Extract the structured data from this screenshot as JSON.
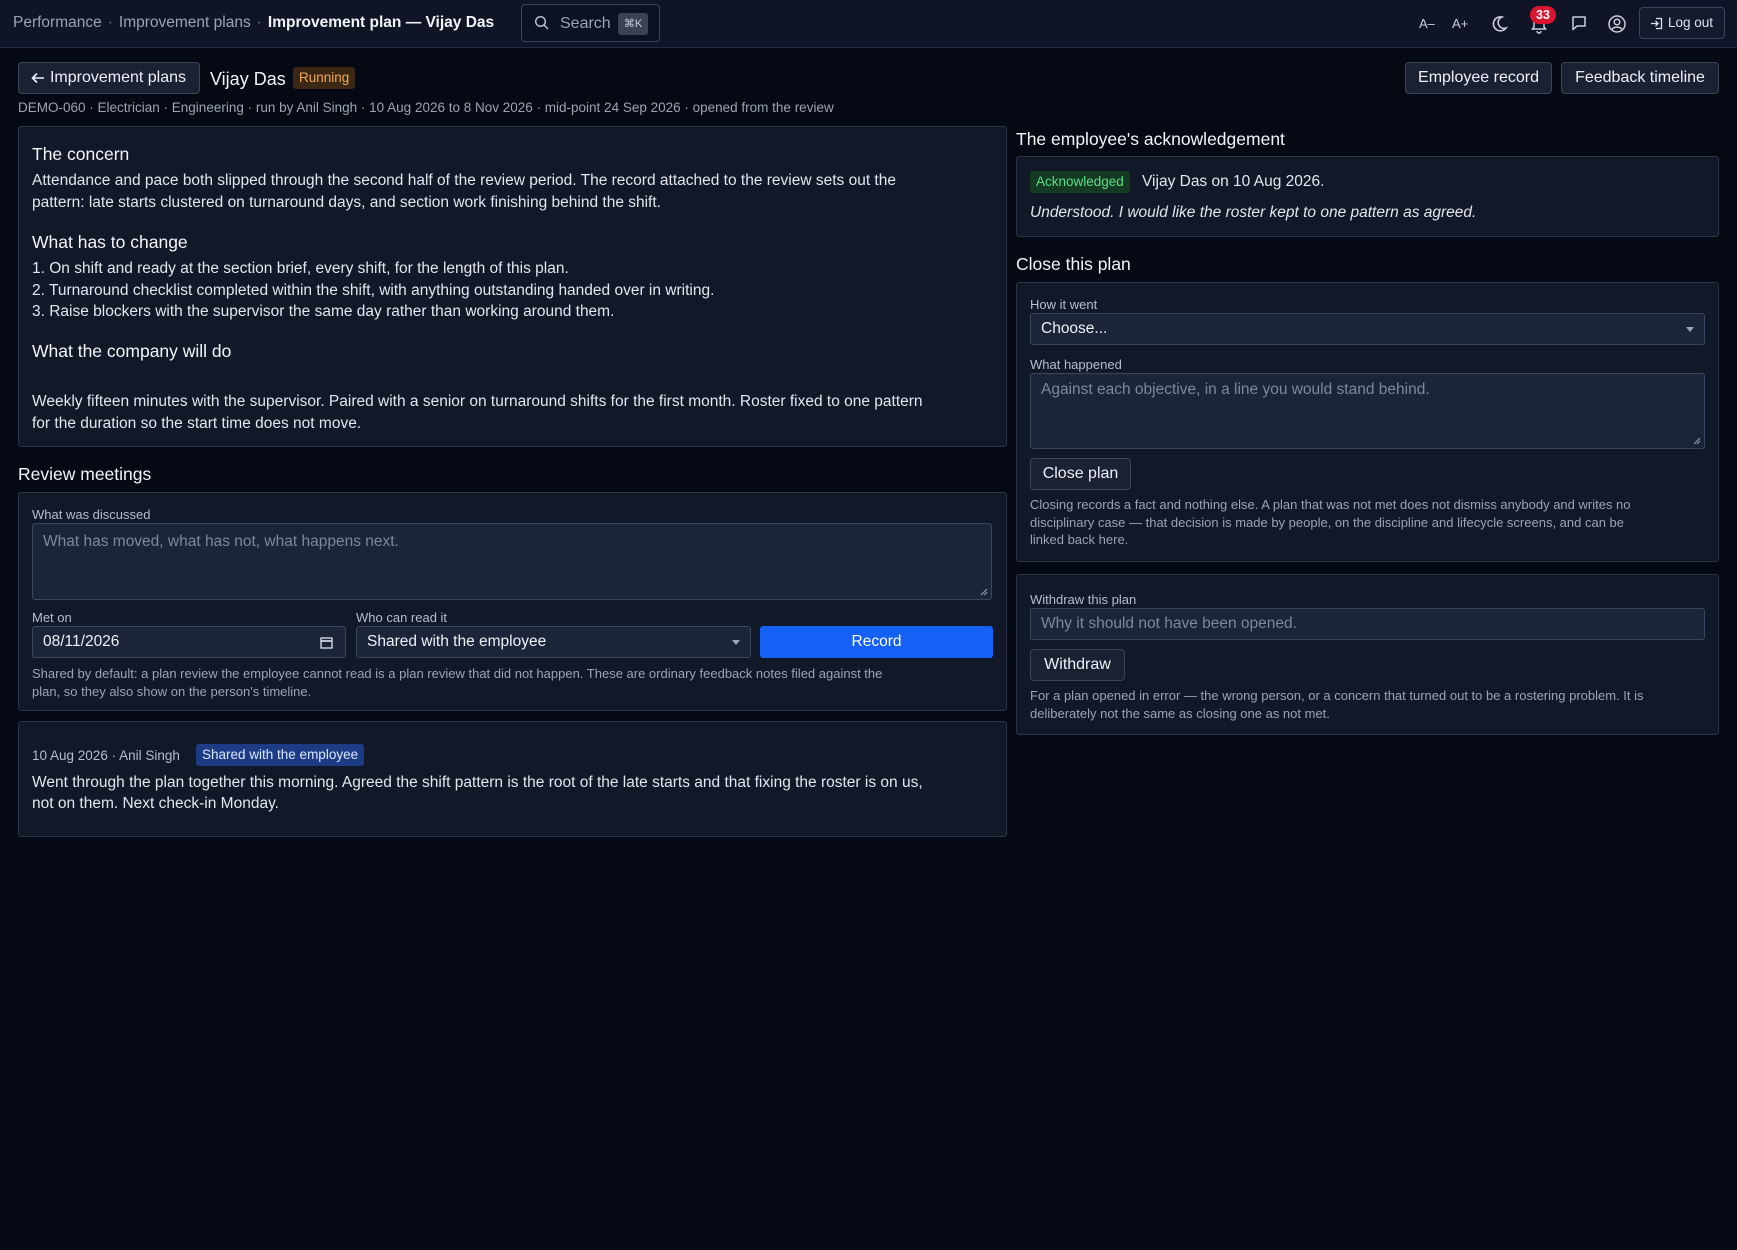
{
  "breadcrumb": {
    "items": [
      "Performance",
      "Improvement plans"
    ],
    "separator": "·",
    "current": "Improvement plan — Vijay Das"
  },
  "search": {
    "label": "Search",
    "shortcut": "⌘K"
  },
  "topbar": {
    "font_smaller": "A–",
    "font_larger": "A+",
    "notification_count": "33",
    "logout_label": "Log out"
  },
  "header": {
    "back_label": "Improvement plans",
    "employee_name": "Vijay Das",
    "status": "Running",
    "employee_record_label": "Employee record",
    "feedback_timeline_label": "Feedback timeline",
    "meta": "DEMO-060 · Electrician · Engineering · run by Anil Singh · 10 Aug 2026 to 8 Nov 2026 · mid-point 24 Sep 2026 · opened from the review"
  },
  "plan": {
    "concern_title": "The concern",
    "concern_line1": "Attendance and pace both slipped through the second half of the review period. The record attached to the review sets out the",
    "concern_line2": "pattern: late starts clustered on turnaround days, and section work finishing behind the shift.",
    "change_title": "What has to change",
    "change_items": [
      "1. On shift and ready at the section brief, every shift, for the length of this plan.",
      "2. Turnaround checklist completed within the shift, with anything outstanding handed over in writing.",
      "3. Raise blockers with the supervisor the same day rather than working around them."
    ],
    "company_title": "What the company will do",
    "company_line1": "Weekly fifteen minutes with the supervisor. Paired with a senior on turnaround shifts for the first month. Roster fixed to one pattern",
    "company_line2": "for the duration so the start time does not move."
  },
  "review": {
    "title": "Review meetings",
    "discussed_label": "What was discussed",
    "discussed_placeholder": "What has moved, what has not, what happens next.",
    "met_on_label": "Met on",
    "met_on_value": "08/11/2026",
    "who_label": "Who can read it",
    "who_value": "Shared with the employee",
    "record_label": "Record",
    "help_line1": "Shared by default: a plan review the employee cannot read is a plan review that did not happen. These are ordinary feedback notes filed against the",
    "help_line2": "plan, so they also show on the person's timeline."
  },
  "note": {
    "meta": "10 Aug 2026 · Anil Singh",
    "visibility": "Shared with the employee",
    "line1": "Went through the plan together this morning. Agreed the shift pattern is the root of the late starts and that fixing the roster is on us,",
    "line2": "not on them. Next check-in Monday."
  },
  "acknowledgement": {
    "title": "The employee's acknowledgement",
    "tag": "Acknowledged",
    "by": "Vijay Das on 10 Aug 2026.",
    "quote": "Understood. I would like the roster kept to one pattern as agreed."
  },
  "close_plan": {
    "title": "Close this plan",
    "how_label": "How it went",
    "how_value": "Choose...",
    "what_label": "What happened",
    "what_placeholder": "Against each objective, in a line you would stand behind.",
    "button": "Close plan",
    "help_line1": "Closing records a fact and nothing else. A plan that was not met does not dismiss anybody and writes no",
    "help_line2": "disciplinary case — that decision is made by people, on the discipline and lifecycle screens, and can be",
    "help_line3": "linked back here."
  },
  "withdraw": {
    "label": "Withdraw this plan",
    "placeholder": "Why it should not have been opened.",
    "button": "Withdraw",
    "help_line1": "For a plan opened in error — the wrong person, or a concern that turned out to be a rostering problem. It is",
    "help_line2": "deliberately not the same as closing one as not met."
  },
  "colors": {
    "background": "#050914",
    "panel": "#111828",
    "primary": "#1560f5",
    "running": "#f4a752",
    "acknowledged": "#5fdc86",
    "badge": "#d9162f"
  },
  "icons": [
    "search-icon",
    "moon-icon",
    "bell-icon",
    "message-icon",
    "user-circle-icon",
    "logout-icon",
    "arrow-left-icon",
    "calendar-icon"
  ]
}
